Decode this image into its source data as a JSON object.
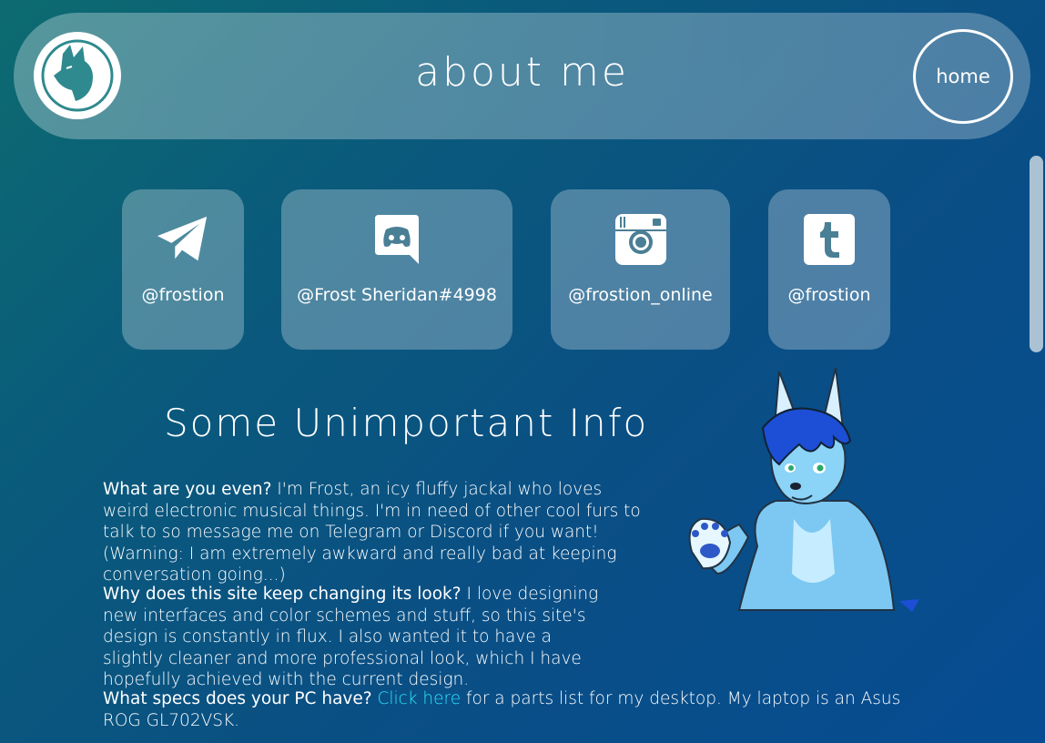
{
  "header": {
    "title": "about me",
    "home_label": "home"
  },
  "socials": [
    {
      "handle": "@frostion",
      "icon": "telegram-icon"
    },
    {
      "handle": "@Frost Sheridan#4998",
      "icon": "discord-icon"
    },
    {
      "handle": "@frostion_online",
      "icon": "instagram-icon"
    },
    {
      "handle": "@frostion",
      "icon": "tumblr-icon"
    }
  ],
  "info": {
    "title": "Some Unimportant Info",
    "q1": "What are you even?",
    "a1": " I'm Frost, an icy fluffy jackal who loves weird electronic musical things. I'm in need of other cool furs to talk to so message me on Telegram or Discord if you want! (Warning: I am extremely awkward and really bad at keeping conversation going...)",
    "q2": "Why does this site keep changing its look?",
    "a2_part1": " I love designing new interfaces and color schemes and stuff, so this site's design is constantly in flux. I also wanted it to have a slightly cleaner and more professional look, which I have hopefully achieved with the current design.",
    "q3": "What specs does your PC have?",
    "link": "Click here",
    "a3": " for a parts list for my desktop. My laptop is an Asus ROG GL702VSK."
  },
  "colors": {
    "accent_link": "#27e6ff",
    "card_bg": "rgba(255,255,255,0.28)"
  }
}
